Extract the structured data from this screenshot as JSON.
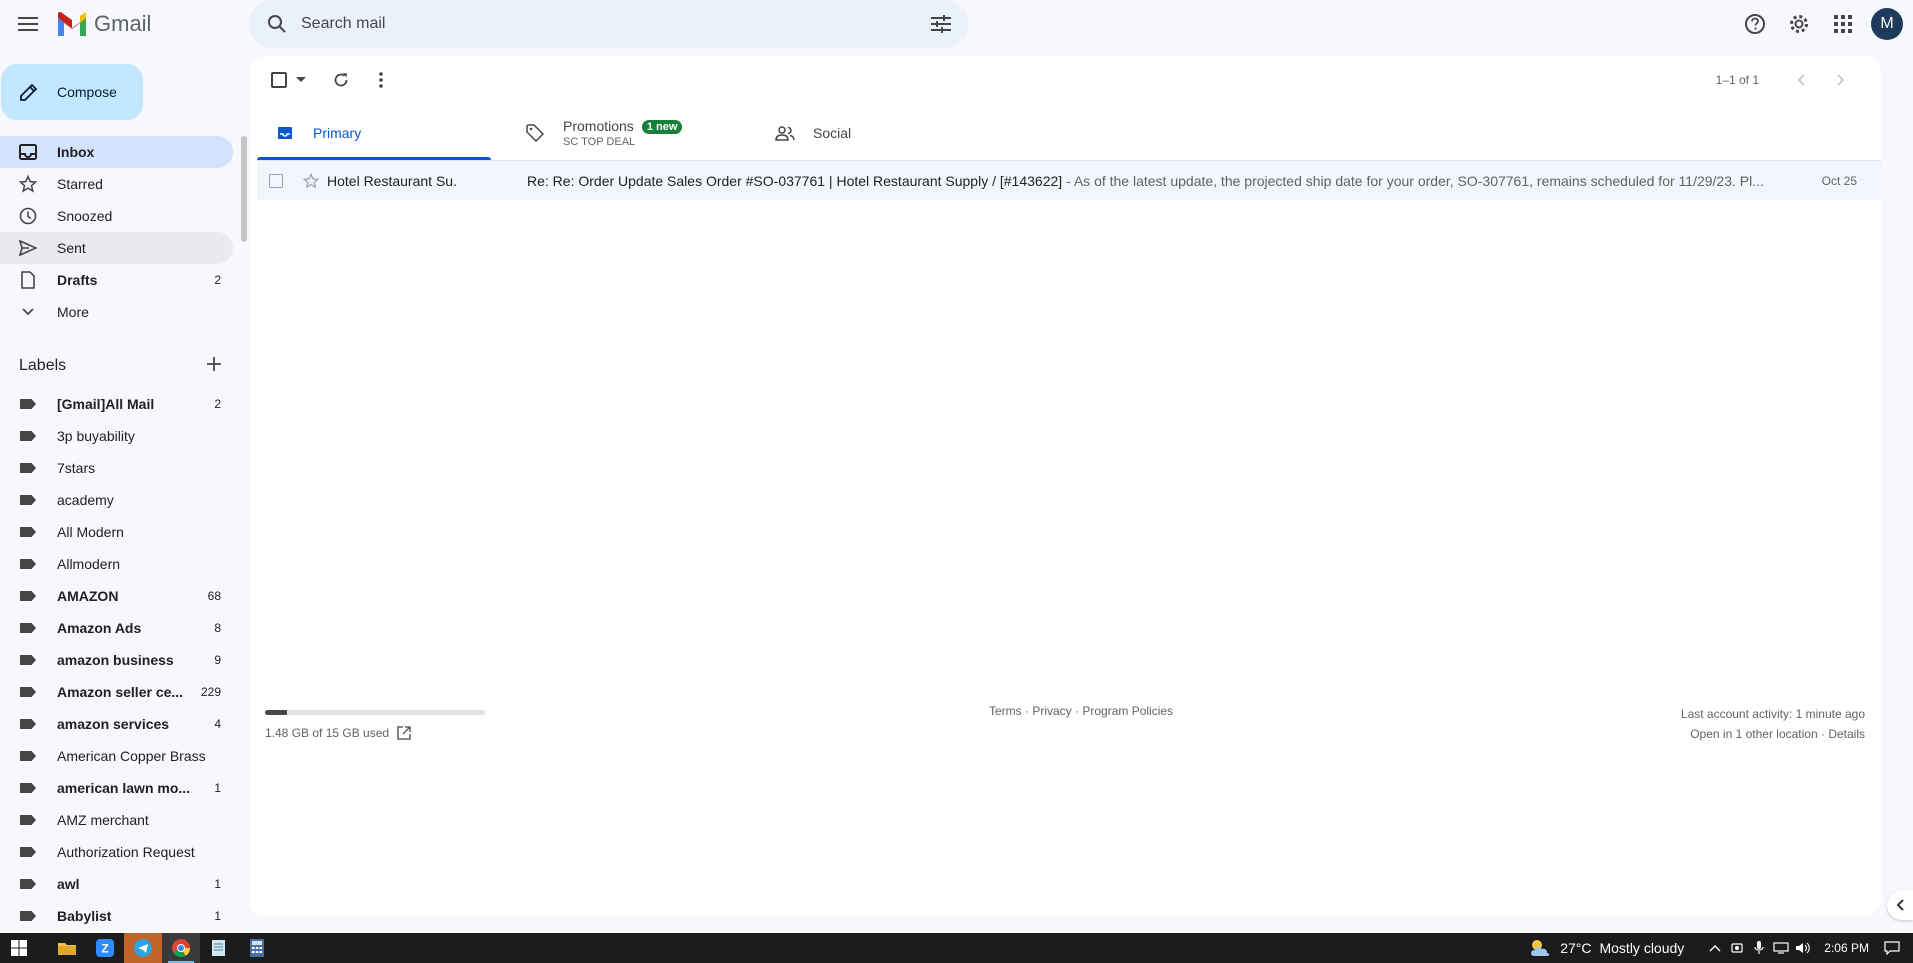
{
  "header": {
    "app_name": "Gmail",
    "search_placeholder": "Search mail",
    "avatar_initial": "M"
  },
  "sidebar": {
    "compose_label": "Compose",
    "nav": [
      {
        "label": "Inbox",
        "count": "",
        "icon": "inbox-icon",
        "active": true
      },
      {
        "label": "Starred",
        "count": "",
        "icon": "star-icon"
      },
      {
        "label": "Snoozed",
        "count": "",
        "icon": "clock-icon"
      },
      {
        "label": "Sent",
        "count": "",
        "icon": "send-icon"
      },
      {
        "label": "Drafts",
        "count": "2",
        "icon": "draft-icon"
      },
      {
        "label": "More",
        "count": "",
        "icon": "chevron-down-icon"
      }
    ],
    "labels_title": "Labels",
    "labels": [
      {
        "label": "[Gmail]All Mail",
        "count": "2",
        "bold": true
      },
      {
        "label": "3p buyability",
        "count": ""
      },
      {
        "label": "7stars",
        "count": ""
      },
      {
        "label": "academy",
        "count": ""
      },
      {
        "label": "All Modern",
        "count": ""
      },
      {
        "label": "Allmodern",
        "count": ""
      },
      {
        "label": "AMAZON",
        "count": "68",
        "bold": true
      },
      {
        "label": "Amazon Ads",
        "count": "8",
        "bold": true
      },
      {
        "label": "amazon business",
        "count": "9",
        "bold": true
      },
      {
        "label": "Amazon seller ce...",
        "count": "229",
        "bold": true
      },
      {
        "label": "amazon services",
        "count": "4",
        "bold": true
      },
      {
        "label": "American Copper Brass",
        "count": ""
      },
      {
        "label": "american lawn mo...",
        "count": "1",
        "bold": true
      },
      {
        "label": "AMZ merchant",
        "count": ""
      },
      {
        "label": "Authorization Request",
        "count": ""
      },
      {
        "label": "awl",
        "count": "1",
        "bold": true
      },
      {
        "label": "Babylist",
        "count": "1",
        "bold": true
      }
    ]
  },
  "toolbar": {
    "pagination": "1–1 of 1"
  },
  "tabs": [
    {
      "label": "Primary",
      "sub": "",
      "badge": "",
      "icon": "inbox-icon",
      "active": true
    },
    {
      "label": "Promotions",
      "sub": "SC TOP DEAL",
      "badge": "1 new",
      "icon": "tag-icon"
    },
    {
      "label": "Social",
      "sub": "",
      "badge": "",
      "icon": "people-icon"
    }
  ],
  "emails": [
    {
      "sender": "Hotel Restaurant Su.",
      "subject": "Re: Re: Order Update Sales Order #SO-037761 | Hotel Restaurant Supply / [#143622]",
      "snippet": " - As of the latest update, the projected ship date for your order, SO-307761, remains scheduled for 11/29/23. Pl...",
      "date": "Oct 25"
    }
  ],
  "footer": {
    "storage_text": "1.48 GB of 15 GB used",
    "storage_fraction": 0.099,
    "terms": "Terms",
    "privacy": "Privacy",
    "program_policies": "Program Policies",
    "separator": " · ",
    "activity_line1": "Last account activity: 1 minute ago",
    "activity_line2": "Open in 1 other location",
    "details": "Details"
  },
  "taskbar": {
    "temperature": "27°C",
    "weather": "Mostly cloudy",
    "time": "2:06 PM"
  }
}
